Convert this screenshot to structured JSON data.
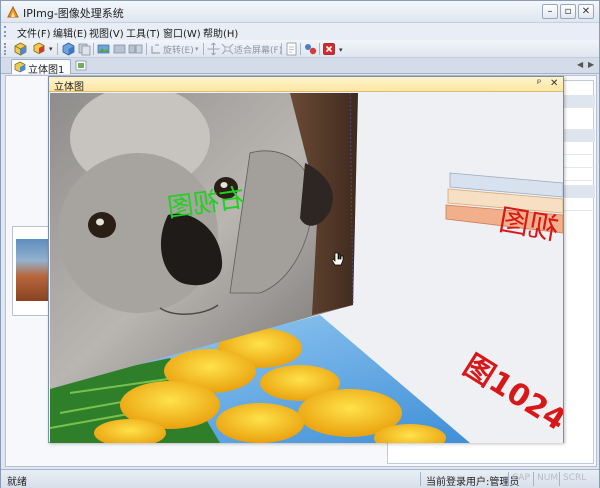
{
  "app": {
    "title": "IPImg-图像处理系统"
  },
  "window_controls": {
    "minimize": "–",
    "restore": "▫",
    "close": "✕"
  },
  "menu": {
    "items": [
      "文件(F)",
      "编辑(E)",
      "视图(V)",
      "工具(T)",
      "窗口(W)",
      "帮助(H)"
    ]
  },
  "toolbar": {
    "rotate_label": "旋转(E)",
    "fit_screen_label": "适合屏幕(F)"
  },
  "tabs": {
    "document_tab": "立体图1"
  },
  "float_window": {
    "title": "立体图",
    "pin": "ᵖ",
    "close": "✕"
  },
  "canvas": {
    "koala_caption": "右视图",
    "right_caption": "视图",
    "bottom_caption": "图1024"
  },
  "status": {
    "left": "就绪",
    "user": "当前登录用户:管理员",
    "keys": [
      "CAP",
      "NUM",
      "SCRL"
    ]
  },
  "colors": {
    "accent_title": "#fbe6a5",
    "green_text": "#1fd21f",
    "red_text": "#d81818",
    "sky_blue": "#5aa9e6",
    "tulip_yellow": "#f4c21a"
  }
}
